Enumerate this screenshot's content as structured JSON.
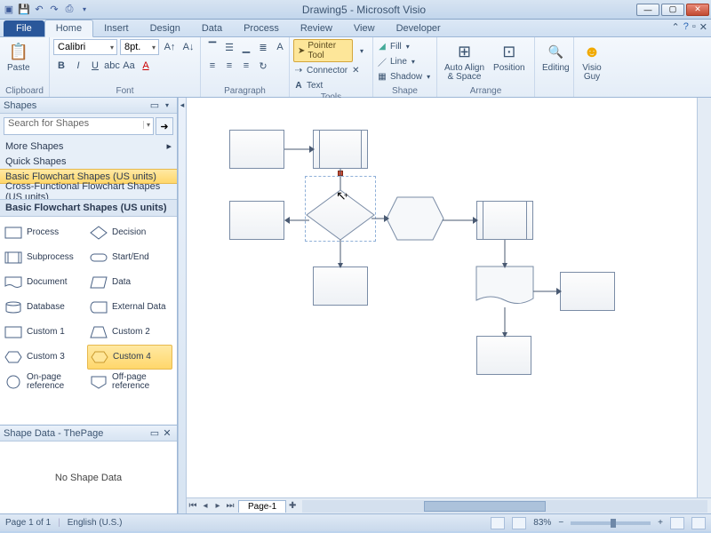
{
  "window": {
    "title": "Drawing5 - Microsoft Visio"
  },
  "tabs": {
    "file": "File",
    "items": [
      "Home",
      "Insert",
      "Design",
      "Data",
      "Process",
      "Review",
      "View",
      "Developer"
    ],
    "active": "Home"
  },
  "ribbon": {
    "clipboard": {
      "paste": "Paste",
      "title": "Clipboard"
    },
    "font": {
      "name": "Calibri",
      "size": "8pt.",
      "title": "Font"
    },
    "paragraph": {
      "title": "Paragraph"
    },
    "tools": {
      "pointer": "Pointer Tool",
      "connector": "Connector",
      "text": "Text",
      "title": "Tools"
    },
    "shape": {
      "fill": "Fill",
      "line": "Line",
      "shadow": "Shadow",
      "title": "Shape"
    },
    "arrange": {
      "autoalign": "Auto Align\n& Space",
      "position": "Position",
      "title": "Arrange"
    },
    "editing": {
      "label": "Editing"
    },
    "visioguy": {
      "label": "Visio\nGuy"
    }
  },
  "shapesPane": {
    "header": "Shapes",
    "searchPlaceholder": "Search for Shapes",
    "moreShapes": "More Shapes",
    "quickShapes": "Quick Shapes",
    "cat1": "Basic Flowchart Shapes (US units)",
    "cat2": "Cross-Functional Flowchart Shapes (US units)",
    "stencilTitle": "Basic Flowchart Shapes (US units)",
    "shapes": {
      "process": "Process",
      "decision": "Decision",
      "subprocess": "Subprocess",
      "startend": "Start/End",
      "document": "Document",
      "data": "Data",
      "database": "Database",
      "extdata": "External Data",
      "custom1": "Custom 1",
      "custom2": "Custom 2",
      "custom3": "Custom 3",
      "custom4": "Custom 4",
      "onpage": "On-page\nreference",
      "offpage": "Off-page\nreference"
    }
  },
  "shapeData": {
    "header": "Shape Data - ThePage",
    "empty": "No Shape Data"
  },
  "pagebar": {
    "page": "Page-1"
  },
  "status": {
    "page": "Page 1 of 1",
    "lang": "English (U.S.)",
    "zoom": "83%"
  }
}
